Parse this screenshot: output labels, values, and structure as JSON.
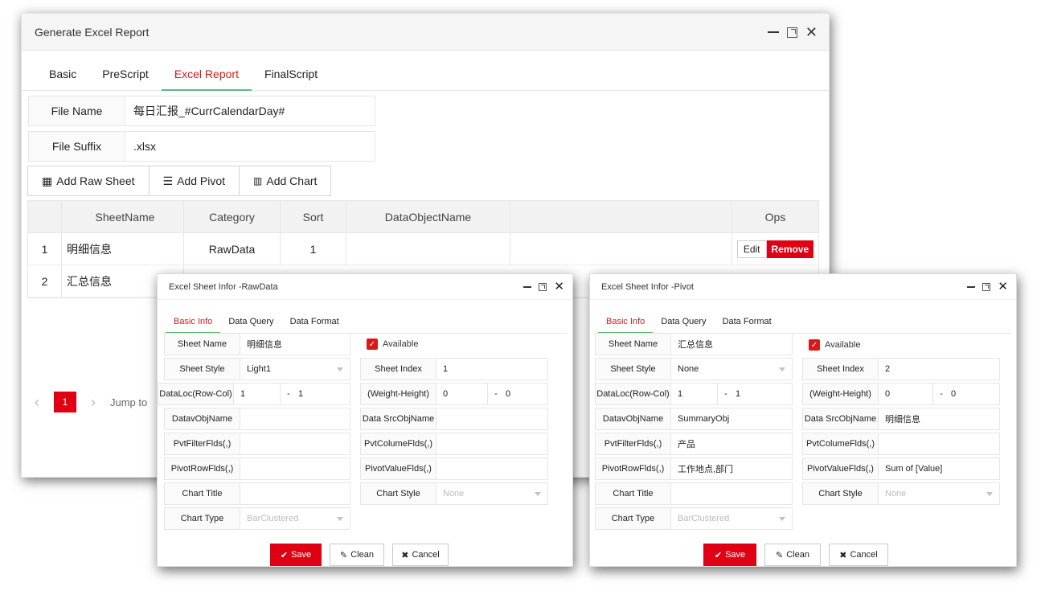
{
  "main": {
    "title": "Generate Excel Report",
    "tabs": [
      {
        "label": "Basic"
      },
      {
        "label": "PreScript"
      },
      {
        "label": "Excel Report"
      },
      {
        "label": "FinalScript"
      }
    ],
    "file_name_label": "File Name",
    "file_name_value": "每日汇报_#CurrCalendarDay#",
    "file_suffix_label": "File Suffix",
    "file_suffix_value": ".xlsx",
    "buttons": {
      "add_raw_sheet": "Add Raw Sheet",
      "add_pivot": "Add Pivot",
      "add_chart": "Add Chart"
    },
    "table": {
      "headers": [
        "SheetName",
        "Category",
        "Sort",
        "DataObjectName",
        "",
        "Ops"
      ],
      "rows": [
        {
          "idx": "1",
          "name": "明细信息",
          "category": "RawData",
          "sort": "1",
          "obj": ""
        },
        {
          "idx": "2",
          "name": "汇总信息"
        }
      ],
      "edit_label": "Edit",
      "remove_label": "Remove"
    },
    "pager": {
      "current": "1",
      "jump_label": "Jump to"
    }
  },
  "dialogs": [
    {
      "title": "Excel Sheet Infor -RawData",
      "tabs": [
        "Basic Info",
        "Data Query",
        "Data Format"
      ],
      "sheet_name_label": "Sheet Name",
      "sheet_name": "明细信息",
      "available_label": "Available",
      "sheet_style_label": "Sheet Style",
      "sheet_style": "Light1",
      "sheet_index_label": "Sheet Index",
      "sheet_index": "1",
      "dataloc_label": "DataLoc(Row-Col)",
      "dataloc_row": "1",
      "dataloc_col": "1",
      "wh_label": "(Weight-Height)",
      "weight": "0",
      "height": "0",
      "datavobj_label": "DatavObjName",
      "datavobj": "",
      "datasrc_label": "Data SrcObjName",
      "datasrc": "",
      "pvtfilter_label": "PvtFilterFlds(,)",
      "pvtfilter": "",
      "pvtcolume_label": "PvtColumeFlds(,)",
      "pvtcolume": "",
      "pivotrow_label": "PivotRowFlds(,)",
      "pivotrow": "",
      "pivotvalue_label": "PivotValueFlds(,)",
      "pivotvalue": "",
      "chart_title_label": "Chart Title",
      "chart_title": "",
      "chart_style_label": "Chart Style",
      "chart_style": "None",
      "chart_type_label": "Chart Type",
      "chart_type": "BarClustered",
      "save": "Save",
      "clean": "Clean",
      "cancel": "Cancel"
    },
    {
      "title": "Excel Sheet Infor -Pivot",
      "tabs": [
        "Basic Info",
        "Data Query",
        "Data Format"
      ],
      "sheet_name_label": "Sheet Name",
      "sheet_name": "汇总信息",
      "available_label": "Available",
      "sheet_style_label": "Sheet Style",
      "sheet_style": "None",
      "sheet_index_label": "Sheet Index",
      "sheet_index": "2",
      "dataloc_label": "DataLoc(Row-Col)",
      "dataloc_row": "1",
      "dataloc_col": "1",
      "wh_label": "(Weight-Height)",
      "weight": "0",
      "height": "0",
      "datavobj_label": "DatavObjName",
      "datavobj": "SummaryObj",
      "datasrc_label": "Data SrcObjName",
      "datasrc": "明细信息",
      "pvtfilter_label": "PvtFilterFlds(,)",
      "pvtfilter": "产品",
      "pvtcolume_label": "PvtColumeFlds(,)",
      "pvtcolume": "",
      "pivotrow_label": "PivotRowFlds(,)",
      "pivotrow": "工作地点,部门",
      "pivotvalue_label": "PivotValueFlds(,)",
      "pivotvalue": "Sum of [Value]",
      "chart_title_label": "Chart Title",
      "chart_title": "",
      "chart_style_label": "Chart Style",
      "chart_style": "None",
      "chart_type_label": "Chart Type",
      "chart_type": "BarClustered",
      "save": "Save",
      "clean": "Clean",
      "cancel": "Cancel"
    }
  ]
}
